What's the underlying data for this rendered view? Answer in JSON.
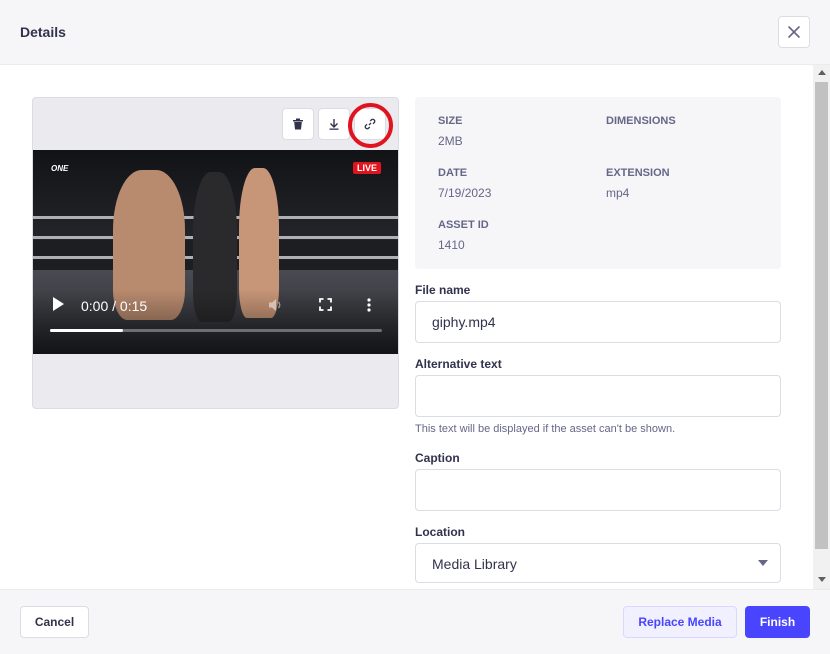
{
  "header": {
    "title": "Details",
    "close_icon": "close-icon"
  },
  "preview": {
    "actions": [
      "delete-icon",
      "download-icon",
      "link-icon"
    ],
    "video": {
      "logo_text": "ONE",
      "live_badge": "LIVE",
      "time": "0:00 / 0:15",
      "progress": 0.22
    }
  },
  "meta": {
    "size_label": "Size",
    "size_value": "2MB",
    "dimensions_label": "Dimensions",
    "date_label": "Date",
    "date_value": "7/19/2023",
    "extension_label": "Extension",
    "extension_value": "mp4",
    "asset_id_label": "Asset ID",
    "asset_id_value": "1410"
  },
  "form": {
    "file_name_label": "File name",
    "file_name_value": "giphy.mp4",
    "alt_text_label": "Alternative text",
    "alt_text_value": "",
    "alt_text_hint": "This text will be displayed if the asset can't be shown.",
    "caption_label": "Caption",
    "caption_value": "",
    "location_label": "Location",
    "location_value": "Media Library"
  },
  "footer": {
    "cancel_label": "Cancel",
    "replace_label": "Replace Media",
    "finish_label": "Finish"
  },
  "colors": {
    "primary": "#4945ff",
    "highlight": "#e0141e",
    "live": "#e0141e"
  }
}
